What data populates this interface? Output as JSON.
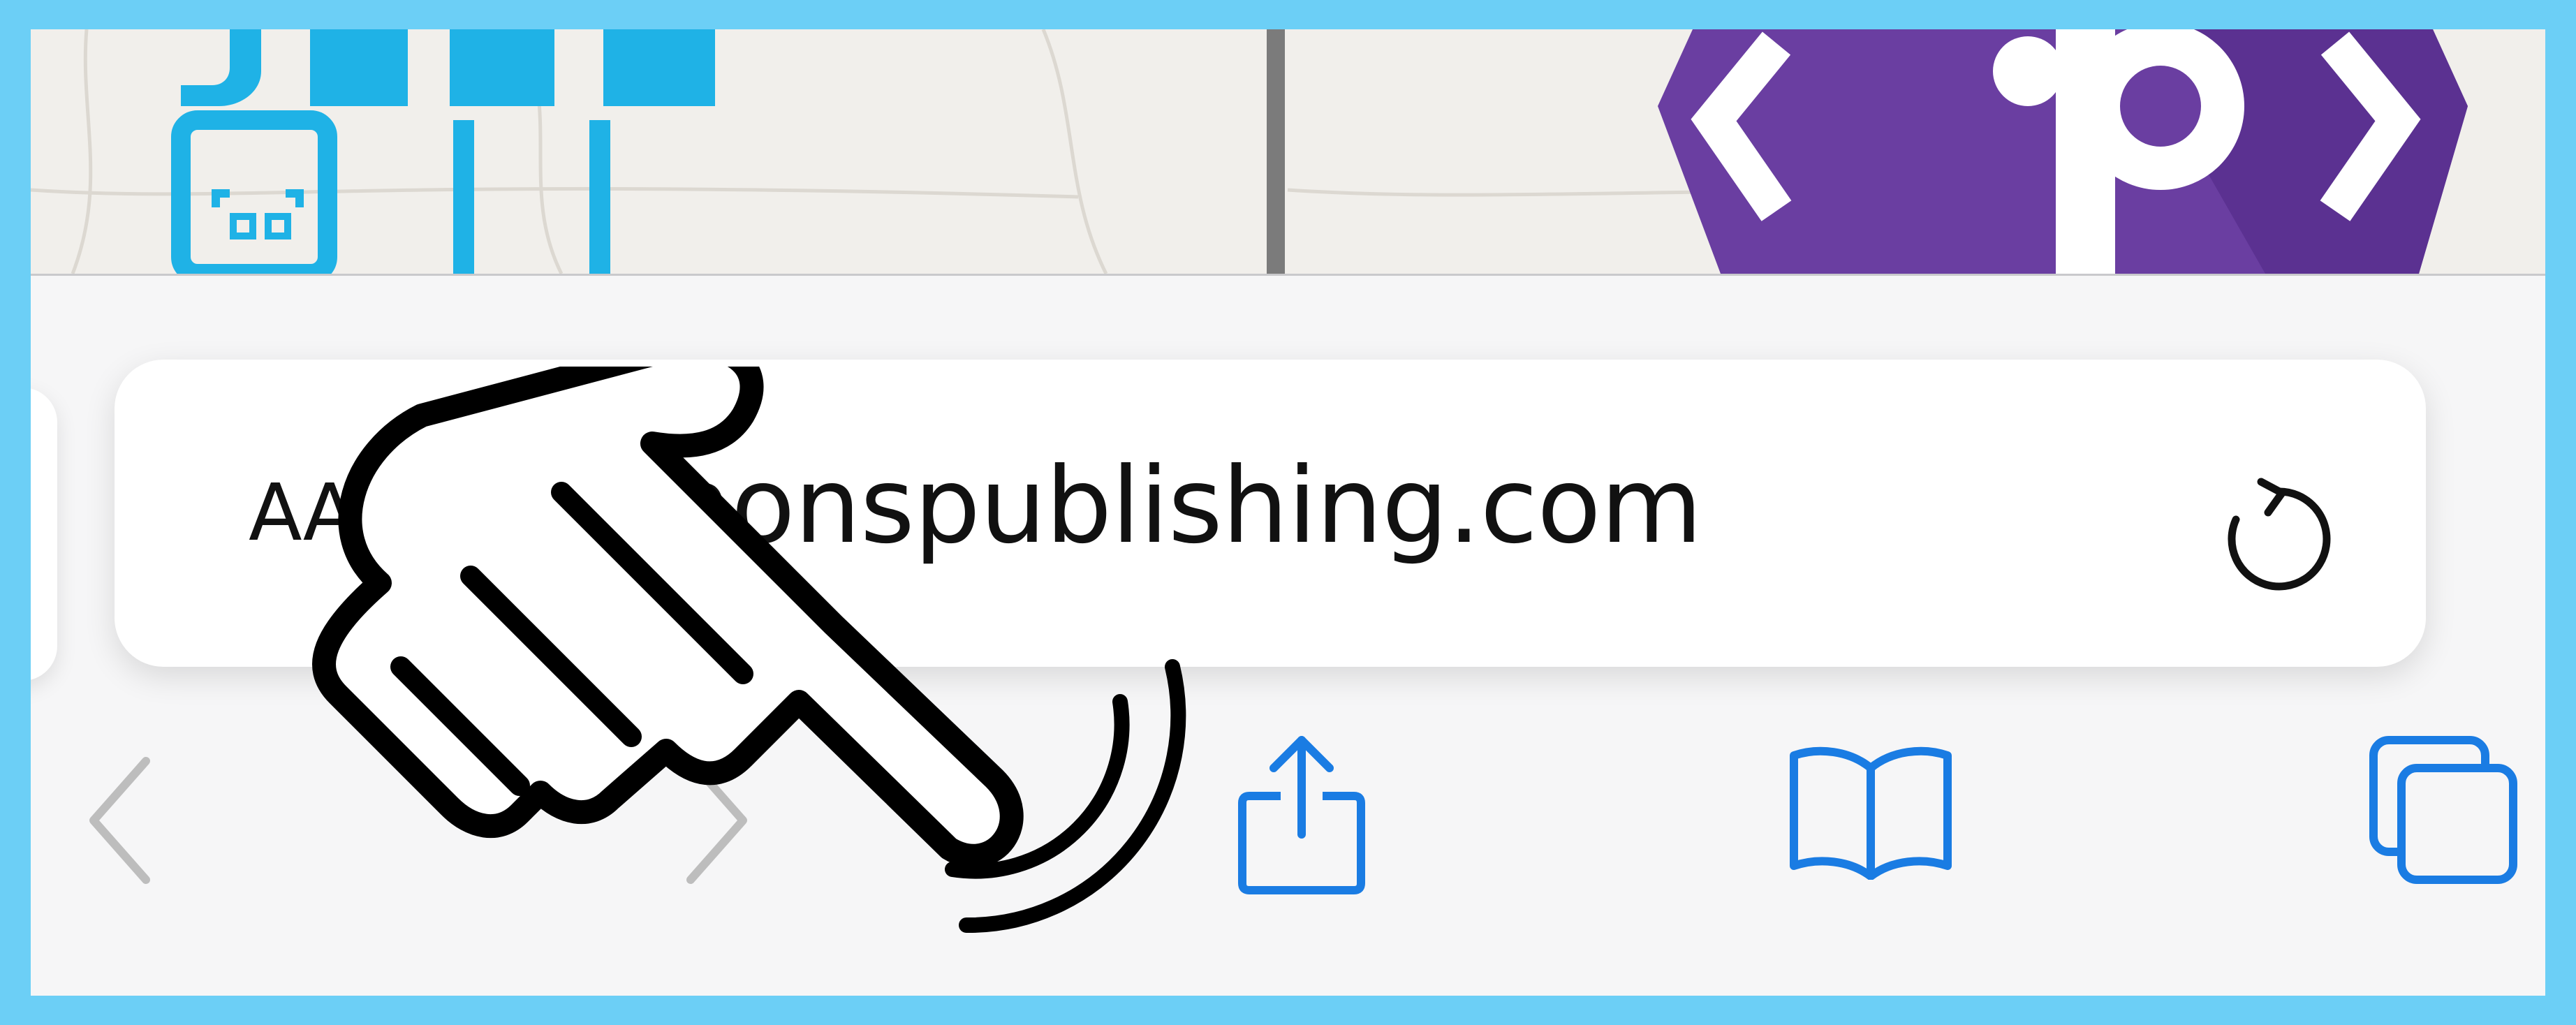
{
  "browser": {
    "address_bar": {
      "text_size_label": "AA",
      "url": "simonspublishing.com"
    }
  },
  "toolbar": {
    "back": {
      "icon": "chevron-left-icon",
      "enabled": false
    },
    "forward": {
      "icon": "chevron-right-icon",
      "enabled": false
    },
    "share": {
      "icon": "share-icon"
    },
    "bookmarks": {
      "icon": "book-icon"
    },
    "tabs": {
      "icon": "tabs-icon"
    }
  },
  "colors": {
    "frame_border": "#6ccff6",
    "accent_blue": "#1a7ce3",
    "disabled_gray": "#bdbdbd",
    "logo_purple": "#6a3ea1",
    "scan_cyan": "#1fb2e6"
  }
}
